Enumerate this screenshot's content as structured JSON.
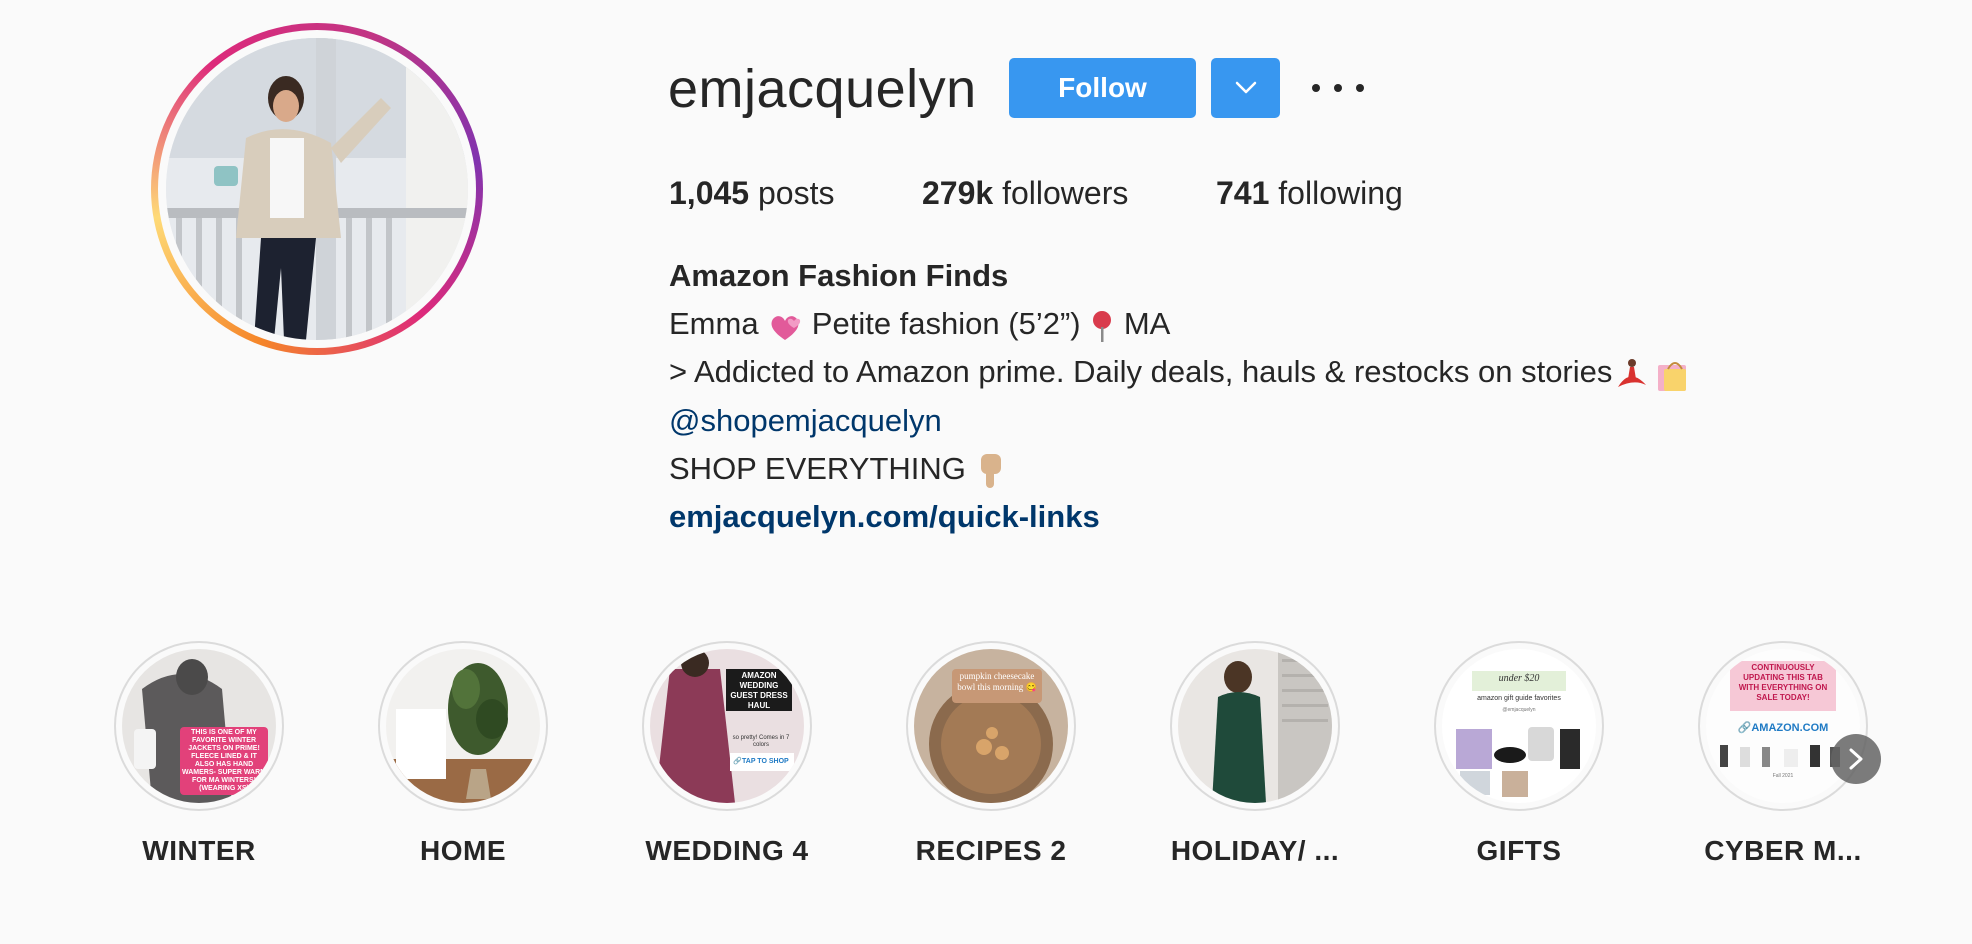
{
  "profile": {
    "username": "emjacquelyn",
    "follow_label": "Follow"
  },
  "stats": {
    "posts_count": "1,045",
    "posts_label": " posts",
    "followers_count": "279k",
    "followers_label": " followers",
    "following_count": "741",
    "following_label": " following"
  },
  "bio": {
    "name": "Amazon Fashion Finds",
    "line1_a": "Emma ",
    "line1_b": " Petite fashion (5’2”) ",
    "line1_c": " MA",
    "line2": "> Addicted to Amazon prime. Daily deals, hauls & restocks on stories",
    "mention": "@shopemjacquelyn",
    "shop": "SHOP EVERYTHING ",
    "link": "emjacquelyn.com/quick-links"
  },
  "highlights": [
    {
      "label": "WINTER",
      "overlay": "THIS IS ONE OF MY FAVORITE WINTER JACKETS ON PRIME! FLEECE LINED & IT ALSO HAS HAND WAMERS- SUPER WARM FOR MA WINTERS! (WEARING XS)"
    },
    {
      "label": "HOME"
    },
    {
      "label": "WEDDING 4",
      "overlay": "AMAZON WEDDING GUEST DRESS HAUL",
      "sub": "so pretty! Comes in 7 colors",
      "tap": "🔗TAP TO SHOP"
    },
    {
      "label": "RECIPES 2",
      "overlay": "pumpkin cheesecake bowl this morning 😋"
    },
    {
      "label": "HOLIDAY/ ..."
    },
    {
      "label": "GIFTS",
      "overlay": "under $20",
      "sub": "amazon gift guide favorites",
      "tag": "@emjacquelyn"
    },
    {
      "label": "CYBER M...",
      "overlay": "CONTINUOUSLY UPDATING THIS TAB WITH EVERYTHING ON SALE TODAY!",
      "link": "🔗AMAZON.COM",
      "sub": "Fall 2021"
    }
  ],
  "colors": {
    "accent": "#3897f0",
    "link": "#00376b",
    "text": "#262626",
    "background": "#fafafa"
  }
}
